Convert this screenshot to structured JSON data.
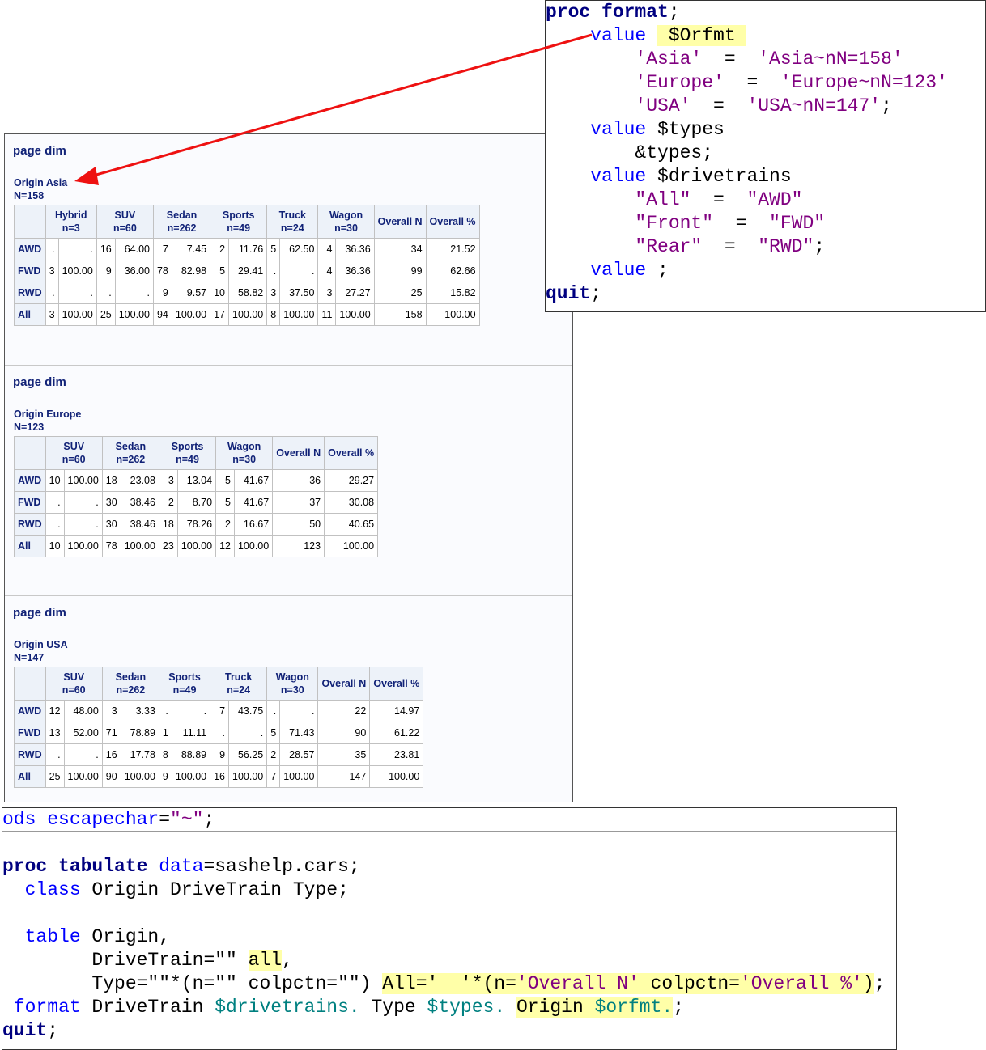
{
  "report": {
    "sections": [
      {
        "page_label": "page dim",
        "origin": "Origin Asia",
        "n": "N=158",
        "groups": [
          [
            "Hybrid",
            "n=3"
          ],
          [
            "SUV",
            "n=60"
          ],
          [
            "Sedan",
            "n=262"
          ],
          [
            "Sports",
            "n=49"
          ],
          [
            "Truck",
            "n=24"
          ],
          [
            "Wagon",
            "n=30"
          ]
        ],
        "overall_n": "Overall N",
        "overall_pct": "Overall %",
        "rows": [
          {
            "label": "AWD",
            "cells": [
              ".",
              ".",
              "16",
              "64.00",
              "7",
              "7.45",
              "2",
              "11.76",
              "5",
              "62.50",
              "4",
              "36.36",
              "34",
              "21.52"
            ]
          },
          {
            "label": "FWD",
            "cells": [
              "3",
              "100.00",
              "9",
              "36.00",
              "78",
              "82.98",
              "5",
              "29.41",
              ".",
              ".",
              "4",
              "36.36",
              "99",
              "62.66"
            ]
          },
          {
            "label": "RWD",
            "cells": [
              ".",
              ".",
              ".",
              ".",
              "9",
              "9.57",
              "10",
              "58.82",
              "3",
              "37.50",
              "3",
              "27.27",
              "25",
              "15.82"
            ]
          },
          {
            "label": "All",
            "cells": [
              "3",
              "100.00",
              "25",
              "100.00",
              "94",
              "100.00",
              "17",
              "100.00",
              "8",
              "100.00",
              "11",
              "100.00",
              "158",
              "100.00"
            ]
          }
        ]
      },
      {
        "page_label": "page dim",
        "origin": "Origin Europe",
        "n": "N=123",
        "groups": [
          [
            "SUV",
            "n=60"
          ],
          [
            "Sedan",
            "n=262"
          ],
          [
            "Sports",
            "n=49"
          ],
          [
            "Wagon",
            "n=30"
          ]
        ],
        "overall_n": "Overall N",
        "overall_pct": "Overall %",
        "rows": [
          {
            "label": "AWD",
            "cells": [
              "10",
              "100.00",
              "18",
              "23.08",
              "3",
              "13.04",
              "5",
              "41.67",
              "36",
              "29.27"
            ]
          },
          {
            "label": "FWD",
            "cells": [
              ".",
              ".",
              "30",
              "38.46",
              "2",
              "8.70",
              "5",
              "41.67",
              "37",
              "30.08"
            ]
          },
          {
            "label": "RWD",
            "cells": [
              ".",
              ".",
              "30",
              "38.46",
              "18",
              "78.26",
              "2",
              "16.67",
              "50",
              "40.65"
            ]
          },
          {
            "label": "All",
            "cells": [
              "10",
              "100.00",
              "78",
              "100.00",
              "23",
              "100.00",
              "12",
              "100.00",
              "123",
              "100.00"
            ]
          }
        ]
      },
      {
        "page_label": "page dim",
        "origin": "Origin USA",
        "n": "N=147",
        "groups": [
          [
            "SUV",
            "n=60"
          ],
          [
            "Sedan",
            "n=262"
          ],
          [
            "Sports",
            "n=49"
          ],
          [
            "Truck",
            "n=24"
          ],
          [
            "Wagon",
            "n=30"
          ]
        ],
        "overall_n": "Overall N",
        "overall_pct": "Overall %",
        "rows": [
          {
            "label": "AWD",
            "cells": [
              "12",
              "48.00",
              "3",
              "3.33",
              ".",
              ".",
              "7",
              "43.75",
              ".",
              ".",
              "22",
              "14.97"
            ]
          },
          {
            "label": "FWD",
            "cells": [
              "13",
              "52.00",
              "71",
              "78.89",
              "1",
              "11.11",
              ".",
              ".",
              "5",
              "71.43",
              "90",
              "61.22"
            ]
          },
          {
            "label": "RWD",
            "cells": [
              ".",
              ".",
              "16",
              "17.78",
              "8",
              "88.89",
              "9",
              "56.25",
              "2",
              "28.57",
              "35",
              "23.81"
            ]
          },
          {
            "label": "All",
            "cells": [
              "25",
              "100.00",
              "90",
              "100.00",
              "9",
              "100.00",
              "16",
              "100.00",
              "7",
              "100.00",
              "147",
              "100.00"
            ]
          }
        ]
      }
    ]
  },
  "code_format": [
    [
      [
        "proc format",
        "k"
      ],
      [
        ";",
        "p"
      ]
    ],
    [
      [
        "    value ",
        "b"
      ],
      [
        " $Orfmt ",
        "p",
        "hl"
      ]
    ],
    [
      [
        "        'Asia'",
        "s"
      ],
      [
        "  =  ",
        "p"
      ],
      [
        "'Asia~nN=158'",
        "s"
      ]
    ],
    [
      [
        "        'Europe'",
        "s"
      ],
      [
        "  =  ",
        "p"
      ],
      [
        "'Europe~nN=123'",
        "s"
      ]
    ],
    [
      [
        "        'USA'",
        "s"
      ],
      [
        "  =  ",
        "p"
      ],
      [
        "'USA~nN=147'",
        "s"
      ],
      [
        ";",
        "p"
      ]
    ],
    [
      [
        "    value ",
        "b"
      ],
      [
        "$types",
        "p"
      ]
    ],
    [
      [
        "        &types;",
        "p"
      ]
    ],
    [
      [
        "    value ",
        "b"
      ],
      [
        "$drivetrains",
        "p"
      ]
    ],
    [
      [
        "        \"All\"",
        "s"
      ],
      [
        "  =  ",
        "p"
      ],
      [
        "\"AWD\"",
        "s"
      ]
    ],
    [
      [
        "        \"Front\"",
        "s"
      ],
      [
        "  =  ",
        "p"
      ],
      [
        "\"FWD\"",
        "s"
      ]
    ],
    [
      [
        "        \"Rear\"",
        "s"
      ],
      [
        "  =  ",
        "p"
      ],
      [
        "\"RWD\"",
        "s"
      ],
      [
        ";",
        "p"
      ]
    ],
    [
      [
        "    value ",
        "b"
      ],
      [
        ";",
        "p"
      ]
    ],
    [
      [
        "quit",
        "k"
      ],
      [
        ";",
        "p"
      ]
    ]
  ],
  "code_tabulate": [
    [
      [
        "ods escapechar",
        "b"
      ],
      [
        "=",
        "p"
      ],
      [
        "\"~\"",
        "s"
      ],
      [
        ";",
        "p"
      ]
    ],
    [],
    [
      [
        "proc tabulate ",
        "k"
      ],
      [
        "data",
        "b"
      ],
      [
        "=sashelp.cars;",
        "p"
      ]
    ],
    [
      [
        "  class ",
        "b"
      ],
      [
        "Origin DriveTrain Type;",
        "p"
      ]
    ],
    [],
    [
      [
        "  table ",
        "b"
      ],
      [
        "Origin,",
        "p"
      ]
    ],
    [
      [
        "        DriveTrain=\"\" ",
        "p"
      ],
      [
        "all",
        "p",
        "hl"
      ],
      [
        ",",
        "p"
      ]
    ],
    [
      [
        "        Type=\"\"*(n=\"\" colpctn=\"\") ",
        "p"
      ],
      [
        "All='  '*(n=",
        "p",
        "hl"
      ],
      [
        "'Overall N'",
        "s",
        "hl"
      ],
      [
        " colpctn=",
        "p",
        "hl"
      ],
      [
        "'Overall %'",
        "s",
        "hl"
      ],
      [
        ")",
        "p",
        "hl"
      ],
      [
        ";",
        "p"
      ]
    ],
    [
      [
        " format ",
        "b"
      ],
      [
        "DriveTrain ",
        "p"
      ],
      [
        "$drivetrains.",
        "f"
      ],
      [
        " Type ",
        "p"
      ],
      [
        "$types.",
        "f"
      ],
      [
        " ",
        "p"
      ],
      [
        "Origin ",
        "p",
        "hl"
      ],
      [
        "$orfmt.",
        "f",
        "hl"
      ],
      [
        ";",
        "p"
      ]
    ],
    [
      [
        "quit",
        "k"
      ],
      [
        ";",
        "p"
      ]
    ]
  ],
  "colors": {
    "arrow": "#ee1111",
    "header_bg": "#edf2f9",
    "header_text": "#112277",
    "highlight": "#ffffa8"
  }
}
